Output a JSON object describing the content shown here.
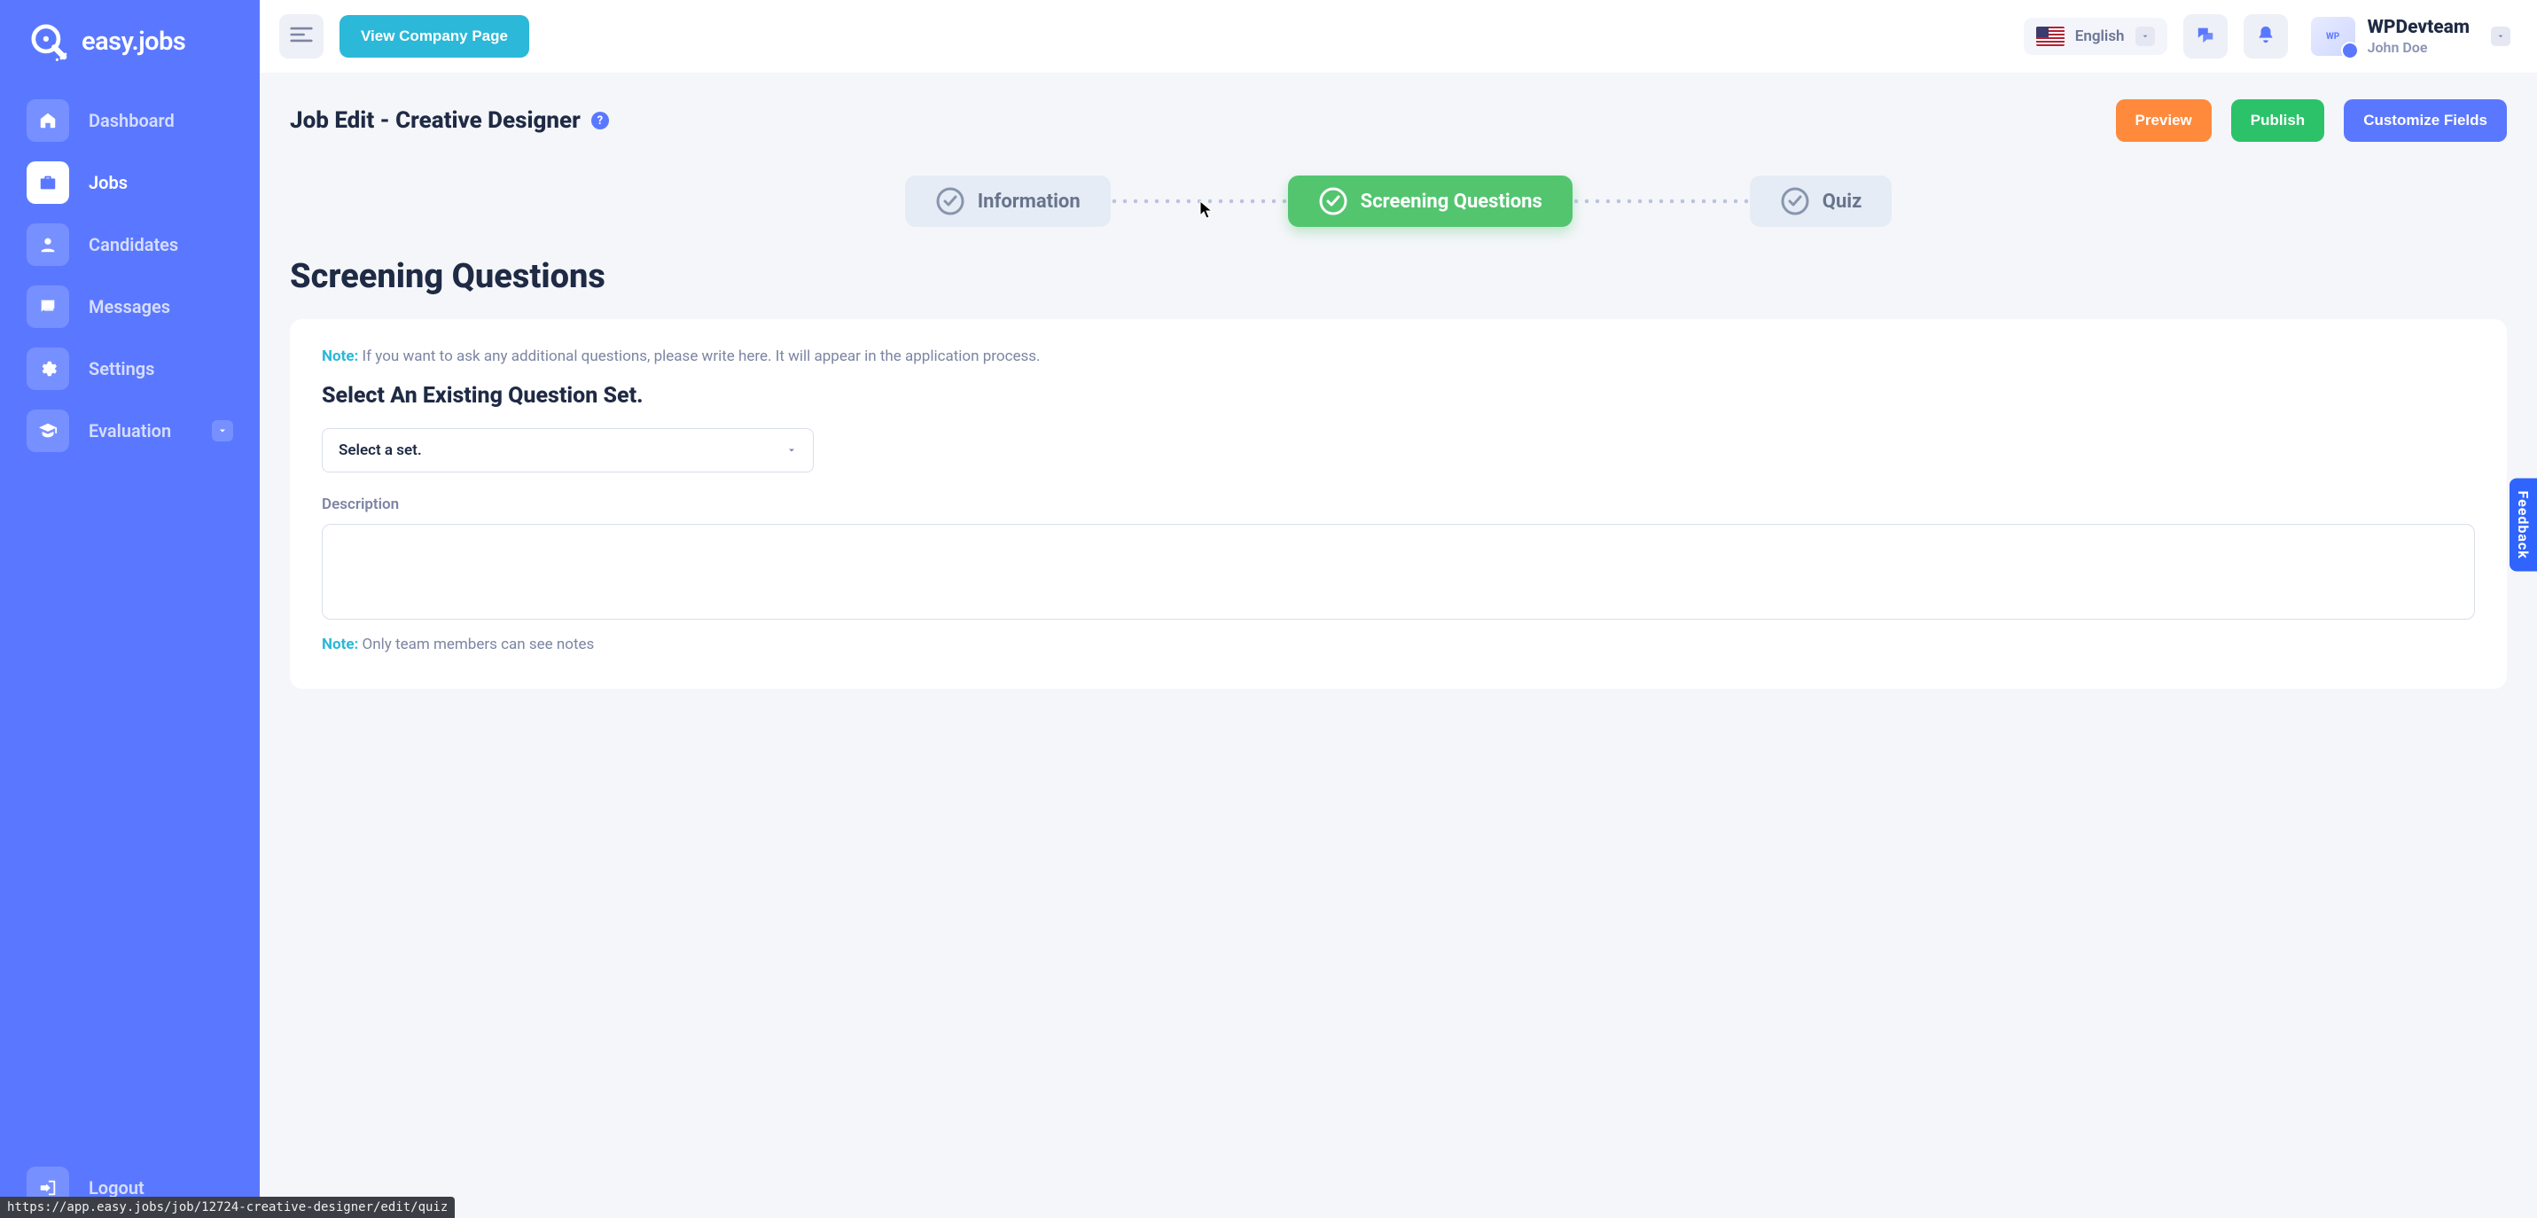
{
  "brand": {
    "name": "easy.jobs"
  },
  "sidebar": {
    "items": [
      {
        "label": "Dashboard"
      },
      {
        "label": "Jobs"
      },
      {
        "label": "Candidates"
      },
      {
        "label": "Messages"
      },
      {
        "label": "Settings"
      },
      {
        "label": "Evaluation"
      }
    ],
    "logout": "Logout"
  },
  "topbar": {
    "view_company": "View Company Page",
    "language": "English",
    "team": "WPDevteam",
    "user": "John Doe"
  },
  "page": {
    "title": "Job Edit - Creative Designer",
    "preview": "Preview",
    "publish": "Publish",
    "customize": "Customize Fields"
  },
  "steps": {
    "info": "Information",
    "screening": "Screening Questions",
    "quiz": "Quiz"
  },
  "section": {
    "title": "Screening Questions",
    "note_label": "Note:",
    "note_text": " If you want to ask any additional questions, please write here. It will appear in the application process.",
    "select_title": "Select An Existing Question Set.",
    "select_placeholder": "Select a set.",
    "description_label": "Description",
    "description_value": "",
    "note2_label": "Note:",
    "note2_text": " Only team members can see notes"
  },
  "feedback": "Feedback",
  "status_url": "https://app.easy.jobs/job/12724-creative-designer/edit/quiz",
  "colors": {
    "primary": "#5a78ff",
    "accent_cyan": "#2cb8d8",
    "accent_green": "#2cc26a",
    "accent_orange": "#ff8a3c"
  }
}
